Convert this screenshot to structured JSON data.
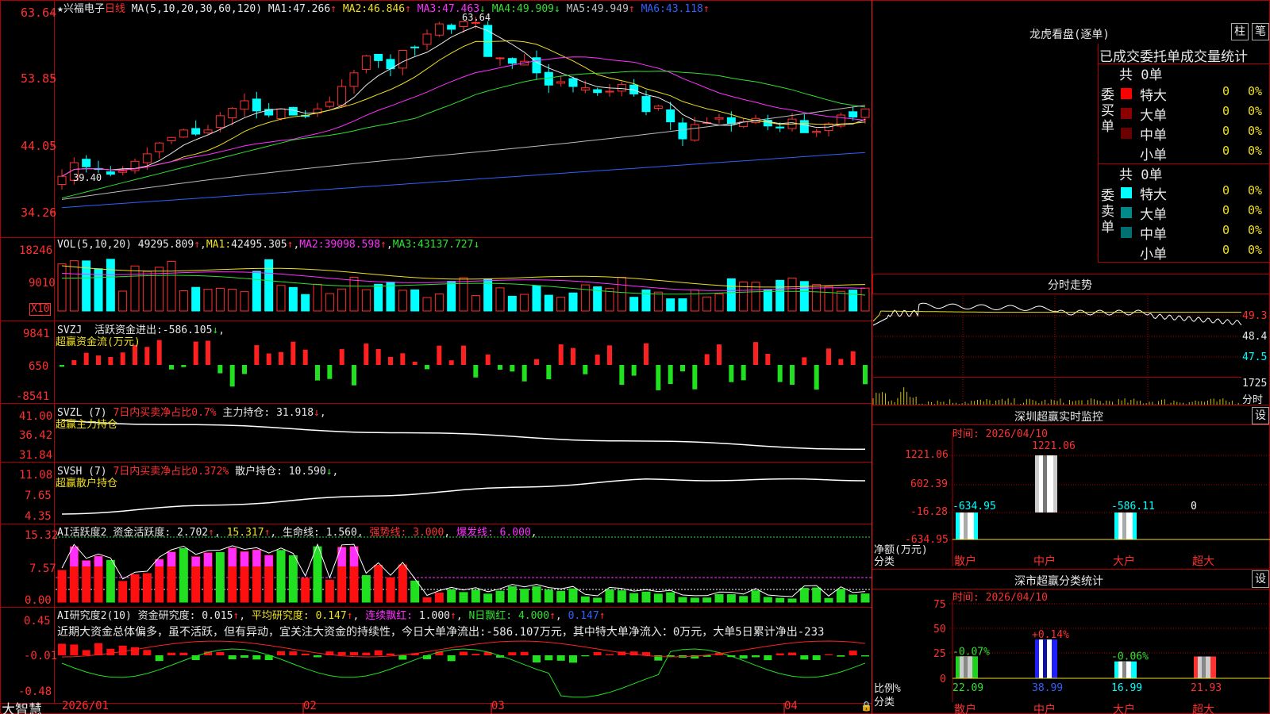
{
  "app_name": "大智慧",
  "stock": {
    "name": "兴福电子",
    "period": "日线"
  },
  "main": {
    "ma_params": "MA(5,10,20,30,60,120)",
    "ma": [
      {
        "label": "MA1:",
        "value": "47.266",
        "arrow": "↑",
        "color": "#e8e8e8"
      },
      {
        "label": "MA2:",
        "value": "46.846",
        "arrow": "↑",
        "color": "#f0e020"
      },
      {
        "label": "MA3:",
        "value": "47.463",
        "arrow": "↓",
        "color": "#ff30ff"
      },
      {
        "label": "MA4:",
        "value": "49.909",
        "arrow": "↓",
        "color": "#30e030"
      },
      {
        "label": "MA5:",
        "value": "49.949",
        "arrow": "↑",
        "color": "#bbbbbb"
      },
      {
        "label": "MA6:",
        "value": "43.118",
        "arrow": "↑",
        "color": "#3060ff"
      }
    ],
    "y_ticks": [
      "63.64",
      "53.85",
      "44.05",
      "34.26"
    ],
    "high_label": "63.64",
    "low_label": "39.40"
  },
  "vol": {
    "params": "VOL(5,10,20)",
    "value": "49295.809",
    "value_arrow": "↑",
    "ma1": "42495.305",
    "ma1_arrow": "↑",
    "ma2": "39098.598",
    "ma2_arrow": "↑",
    "ma3": "43137.727",
    "ma3_arrow": "↓",
    "y_ticks": [
      "18246",
      "9010"
    ],
    "unit": "X10"
  },
  "svzj": {
    "name": "SVZJ",
    "label": "活跃资金进出:",
    "value": "-586.105",
    "arrow": "↓",
    "subtitle": "超赢资金流(万元)",
    "y_ticks": [
      "9841",
      "650",
      "-8541"
    ]
  },
  "svzl": {
    "name": "SVZL (7)",
    "desc": "7日内买卖净占比0.7%",
    "label": "主力持仓:",
    "value": "31.918",
    "arrow": "↓",
    "subtitle": "超赢主力持仓",
    "y_ticks": [
      "41.00",
      "36.42",
      "31.84"
    ]
  },
  "svsh": {
    "name": "SVSH (7)",
    "desc": "7日内买卖净占比0.372%",
    "label": "散户持仓:",
    "value": "10.590",
    "arrow": "↓",
    "subtitle": "超赢散户持仓",
    "y_ticks": [
      "11.08",
      "7.65",
      "4.35"
    ]
  },
  "ai_activity": {
    "name": "AI活跃度2",
    "label": "资金活跃度:",
    "value": "2.702",
    "arrow": "↑",
    "v2": "15.317",
    "v2_arrow": "↑",
    "life_label": "生命线:",
    "life_value": "1.560",
    "strong_label": "强势线:",
    "strong_value": "3.000",
    "burst_label": "爆发线:",
    "burst_value": "6.000",
    "y_ticks": [
      "15.32",
      "7.57",
      "0.00"
    ]
  },
  "ai_research": {
    "name": "AI研究度2(10)",
    "label": "资金研究度:",
    "value": "0.015",
    "arrow": "↑",
    "avg_label": "平均研究度:",
    "avg_value": "0.147",
    "avg_arrow": "↑",
    "red_label": "连续飘红:",
    "red_value": "1.000",
    "red_arrow": "↑",
    "nred_label": "N日飘红:",
    "nred_value": "4.000",
    "nred_arrow": "↑",
    "last_value": "0.147",
    "last_arrow": "↑",
    "comment": "近期大资金总体偏多，虽不活跃，但有异动，宜关注大资金的持续性，今日大单净流出:-586.107万元，其中特大单净流入：0万元，大单5日累计净出-233",
    "y_ticks": [
      "0.45",
      "-0.01",
      "-0.48"
    ]
  },
  "x_labels": [
    "2026/01",
    "02",
    "03",
    "04"
  ],
  "dragon_tiger": {
    "title": "龙虎看盘(逐单)",
    "btn_bar": "柱",
    "btn_list": "笔",
    "header": "已成交委托单成交量统计",
    "buy": {
      "side_label": "委买单",
      "total": "共 0单",
      "rows": [
        {
          "name": "特大",
          "count": "0",
          "pct": "0%",
          "color": "#ff0000"
        },
        {
          "name": "大单",
          "count": "0",
          "pct": "0%",
          "color": "#8b0000"
        },
        {
          "name": "中单",
          "count": "0",
          "pct": "0%",
          "color": "#6b0000"
        },
        {
          "name": "小单",
          "count": "0",
          "pct": "0%",
          "color": ""
        }
      ]
    },
    "sell": {
      "side_label": "委卖单",
      "total": "共 0单",
      "rows": [
        {
          "name": "特大",
          "count": "0",
          "pct": "0%",
          "color": "#00ffff"
        },
        {
          "name": "大单",
          "count": "0",
          "pct": "0%",
          "color": "#008b8b"
        },
        {
          "name": "中单",
          "count": "0",
          "pct": "0%",
          "color": "#007070"
        },
        {
          "name": "小单",
          "count": "0",
          "pct": "0%",
          "color": ""
        }
      ]
    }
  },
  "intraday": {
    "title": "分时走势",
    "y_ticks": [
      "49.3",
      "48.4",
      "47.5"
    ],
    "vol_tick": "1725",
    "unit": "分时"
  },
  "sz_monitor": {
    "title": "深圳超赢实时监控",
    "btn": "设",
    "time_label": "时间: 2026/04/10",
    "y_ticks": [
      "1221.06",
      "602.39",
      "-16.28",
      "-634.95"
    ],
    "net_label": "净额(万元)",
    "cat_label": "分类",
    "categories": [
      "散户",
      "中户",
      "大户",
      "超大"
    ],
    "values": [
      -634.95,
      1221.06,
      -586.11,
      0
    ],
    "value_labels": [
      "-634.95",
      "1221.06",
      "-586.11",
      "0"
    ]
  },
  "sz_classify": {
    "title": "深市超赢分类统计",
    "btn": "设",
    "time_label": "时间: 2026/04/10",
    "y_ticks": [
      "75",
      "50",
      "25",
      "0"
    ],
    "ratio_label": "比例%",
    "cat_label": "分类",
    "categories": [
      "散户",
      "中户",
      "大户",
      "超大"
    ],
    "values": [
      22.09,
      38.99,
      16.99,
      21.93
    ],
    "value_labels": [
      "22.09",
      "38.99",
      "16.99",
      "21.93"
    ],
    "change_labels": [
      "-0.07%",
      "+0.14%",
      "-0.06%",
      ""
    ]
  },
  "chart_data": {
    "type": "candlestick",
    "dates_shown": [
      "2026/01",
      "02",
      "03",
      "04"
    ],
    "close": [
      39.6,
      41.6,
      41.0,
      40.6,
      39.9,
      40.4,
      41.8,
      42.9,
      44.5,
      45.3,
      46.4,
      45.8,
      46.4,
      48.5,
      49.6,
      50.7,
      49.2,
      48.6,
      49.5,
      48.6,
      48.4,
      49.5,
      50.5,
      52.8,
      54.8,
      57.3,
      56.6,
      55.4,
      58.1,
      58.5,
      60.5,
      62.0,
      61.2,
      62.3,
      62.2,
      57.2,
      57.0,
      56.2,
      56.5,
      54.8,
      53.0,
      53.5,
      52.8,
      52.6,
      51.9,
      52.1,
      53.1,
      51.7,
      49.1,
      49.9,
      47.6,
      45.1,
      47.2,
      47.5,
      48.2,
      47.3,
      47.6,
      48.1,
      47.0,
      46.7,
      48.0,
      46.0,
      46.2,
      47.3,
      48.6,
      48.3,
      49.5
    ],
    "ma_series": [
      "MA1",
      "MA2",
      "MA3",
      "MA4",
      "MA5",
      "MA6"
    ],
    "y_range": [
      34.26,
      63.64
    ],
    "volume_unit": "X10",
    "volume_range": [
      0,
      18246
    ]
  }
}
